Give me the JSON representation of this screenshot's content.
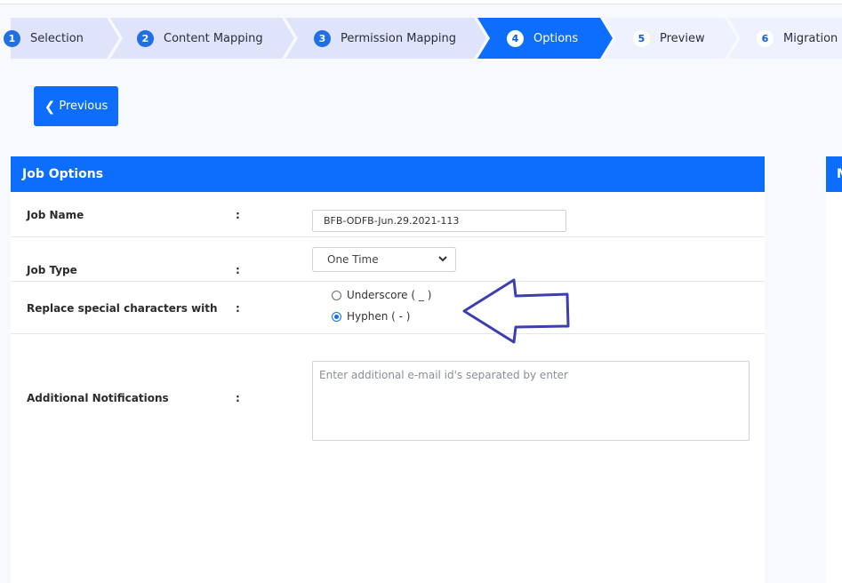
{
  "stepper": {
    "steps": [
      {
        "num": "1",
        "label": "Selection",
        "state": "done"
      },
      {
        "num": "2",
        "label": "Content Mapping",
        "state": "done"
      },
      {
        "num": "3",
        "label": "Permission Mapping",
        "state": "done"
      },
      {
        "num": "4",
        "label": "Options",
        "state": "active"
      },
      {
        "num": "5",
        "label": "Preview",
        "state": "future"
      },
      {
        "num": "6",
        "label": "Migration",
        "state": "future"
      }
    ]
  },
  "nav": {
    "previous_label": "Previous"
  },
  "job_options": {
    "title": "Job Options",
    "separator": ":",
    "job_name": {
      "label": "Job Name",
      "value": "BFB-ODFB-Jun.29.2021-113"
    },
    "job_type": {
      "label": "Job Type",
      "selected": "One Time"
    },
    "replace_chars": {
      "label": "Replace special characters with",
      "options": [
        {
          "label": "Underscore ( _ )",
          "checked": false
        },
        {
          "label": "Hyphen ( - )",
          "checked": true
        }
      ]
    },
    "notifications": {
      "label": "Additional Notifications",
      "placeholder": "Enter additional e-mail id's separated by enter"
    }
  },
  "right_panel": {
    "title": "M"
  },
  "colors": {
    "primary": "#0d6efd",
    "step_done_fill": "#dfe4fb",
    "step_future_fill": "#eef1fe",
    "annotation_arrow": "#3b3fb0"
  }
}
